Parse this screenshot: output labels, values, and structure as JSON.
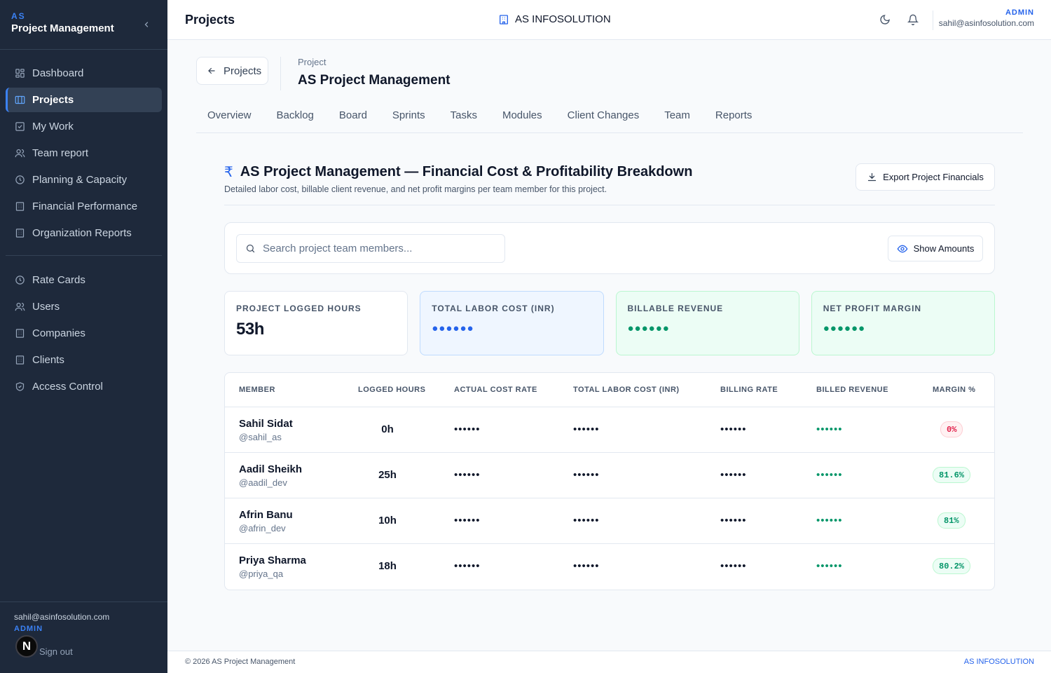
{
  "sidebar": {
    "brand_small": "AS",
    "brand_title": "Project Management",
    "items": [
      {
        "label": "Dashboard",
        "icon": "dashboard-icon"
      },
      {
        "label": "Projects",
        "icon": "projects-icon",
        "active": true
      },
      {
        "label": "My Work",
        "icon": "check-square-icon"
      },
      {
        "label": "Team report",
        "icon": "users-icon"
      },
      {
        "label": "Planning & Capacity",
        "icon": "clock-icon"
      },
      {
        "label": "Financial Performance",
        "icon": "building-icon"
      },
      {
        "label": "Organization Reports",
        "icon": "building-icon"
      }
    ],
    "admin_items": [
      {
        "label": "Rate Cards",
        "icon": "clock-icon"
      },
      {
        "label": "Users",
        "icon": "users-icon"
      },
      {
        "label": "Companies",
        "icon": "building-icon"
      },
      {
        "label": "Clients",
        "icon": "building-icon"
      },
      {
        "label": "Access Control",
        "icon": "shield-icon"
      }
    ],
    "footer": {
      "email": "sahil@asinfosolution.com",
      "role": "ADMIN",
      "badge": "N",
      "signout": "Sign out"
    }
  },
  "header": {
    "title": "Projects",
    "org": "AS INFOSOLUTION",
    "role": "ADMIN",
    "email": "sahil@asinfosolution.com"
  },
  "project": {
    "back_label": "Projects",
    "label": "Project",
    "name": "AS Project Management",
    "tabs": [
      "Overview",
      "Backlog",
      "Board",
      "Sprints",
      "Tasks",
      "Modules",
      "Client Changes",
      "Team",
      "Reports"
    ]
  },
  "financials": {
    "currency_symbol": "₹",
    "title": "AS Project Management — Financial Cost & Profitability Breakdown",
    "subtitle": "Detailed labor cost, billable client revenue, and net profit margins per team member for this project.",
    "export_label": "Export Project Financials",
    "search_placeholder": "Search project team members...",
    "show_amounts_label": "Show Amounts",
    "stats": [
      {
        "label": "PROJECT LOGGED HOURS",
        "value": "53h"
      },
      {
        "label": "TOTAL LABOR COST (INR)",
        "masked": "●●●●●●"
      },
      {
        "label": "BILLABLE REVENUE",
        "masked": "●●●●●●"
      },
      {
        "label": "NET PROFIT MARGIN",
        "masked": "●●●●●●"
      }
    ],
    "columns": [
      "MEMBER",
      "LOGGED HOURS",
      "ACTUAL COST RATE",
      "TOTAL LABOR COST (INR)",
      "BILLING RATE",
      "BILLED REVENUE",
      "MARGIN %"
    ],
    "rows": [
      {
        "name": "Sahil Sidat",
        "handle": "@sahil_as",
        "hours": "0h",
        "cost_rate": "••••••",
        "labor_cost": "••••••",
        "billing_rate": "••••••",
        "revenue": "••••••",
        "margin": "0%",
        "margin_status": "neg"
      },
      {
        "name": "Aadil Sheikh",
        "handle": "@aadil_dev",
        "hours": "25h",
        "cost_rate": "••••••",
        "labor_cost": "••••••",
        "billing_rate": "••••••",
        "revenue": "••••••",
        "margin": "81.6%",
        "margin_status": "pos"
      },
      {
        "name": "Afrin Banu",
        "handle": "@afrin_dev",
        "hours": "10h",
        "cost_rate": "••••••",
        "labor_cost": "••••••",
        "billing_rate": "••••••",
        "revenue": "••••••",
        "margin": "81%",
        "margin_status": "pos"
      },
      {
        "name": "Priya Sharma",
        "handle": "@priya_qa",
        "hours": "18h",
        "cost_rate": "••••••",
        "labor_cost": "••••••",
        "billing_rate": "••••••",
        "revenue": "••••••",
        "margin": "80.2%",
        "margin_status": "pos"
      }
    ]
  },
  "footer": {
    "copyright": "© 2026 AS Project Management",
    "brand": "AS INFOSOLUTION"
  },
  "colors": {
    "sidebar_bg": "#1e293b",
    "accent": "#2563eb",
    "positive": "#059669",
    "negative": "#e11d48"
  }
}
